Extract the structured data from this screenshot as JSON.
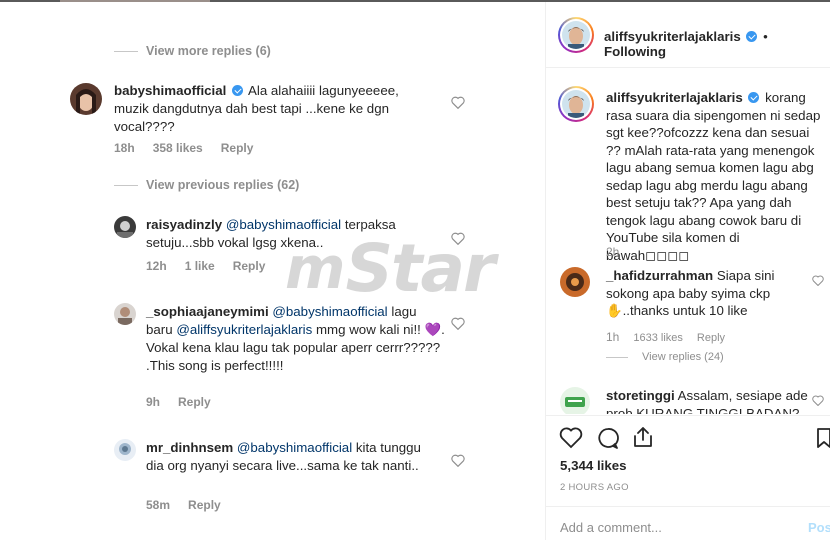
{
  "left": {
    "view_more_replies": "View more replies (6)",
    "main_comment": {
      "username": "babyshimaofficial",
      "text": "Ala alahaiiii lagunyeeeee, muzik dangdutnya dah best tapi ...kene ke dgn vocal????",
      "time": "18h",
      "likes": "358 likes",
      "reply": "Reply"
    },
    "view_previous_replies": "View previous replies (62)",
    "replies": [
      {
        "username": "raisyadinzly",
        "mention": "@babyshimaofficial",
        "text_after_mention": "terpaksa setuju...sbb vokal lgsg xkena..",
        "time": "12h",
        "likes": "1 like",
        "reply": "Reply"
      },
      {
        "username": "_sophiaajaneymimi",
        "mention": "@babyshimaofficial",
        "text_line": "lagu baru",
        "mention2": "@aliffsyukriterlajaklaris",
        "text_after": "mmg wow kali ni!! 💜. Vokal kena klau lagu tak popular aperr cerrr????? .This song is perfect!!!!!",
        "time": "9h",
        "reply": "Reply"
      },
      {
        "username": "mr_dinhnsem",
        "mention": "@babyshimaofficial",
        "text_after_mention": "kita tunggu dia org nyanyi secara live...sama ke  tak nanti..",
        "time": "58m",
        "reply": "Reply"
      }
    ]
  },
  "right": {
    "header": {
      "username": "aliffsyukriterlajaklaris",
      "separator": "•",
      "follow_state": "Following"
    },
    "caption": {
      "username": "aliffsyukriterlajaklaris",
      "text": "korang rasa suara dia sipengomen ni sedap sgt kee??ofcozzz kena dan sesuai ?? mAlah rata-rata yang menengok lagu abang semua komen lagu abg sedap lagu abg merdu lagu abang best setuju tak?? Apa yang dah tengok lagu abang cowok baru di YouTube sila komen di bawah◻◻◻◻",
      "time": "2h"
    },
    "comments": [
      {
        "username": "_hafidzurrahman",
        "text": "Siapa sini sokong apa baby syima ckp",
        "text2": "..thanks untuk 10 like",
        "time": "1h",
        "likes": "1633 likes",
        "reply": "Reply",
        "view_replies": "View replies (24)"
      },
      {
        "username": "storetinggi",
        "text": "Assalam, sesiape ade prob KURANG TINGGI BADAN?"
      }
    ],
    "likes_count": "5,344 likes",
    "time_ago": "2 HOURS AGO",
    "add_comment_placeholder": "Add a comment...",
    "post_label": "Post"
  },
  "watermark": {
    "m": "m",
    "star": "Star"
  },
  "colors": {
    "verified": "#3897f0",
    "mention": "#003569",
    "muted": "#8e8e8e",
    "heart_purple": "#a64fd8"
  }
}
